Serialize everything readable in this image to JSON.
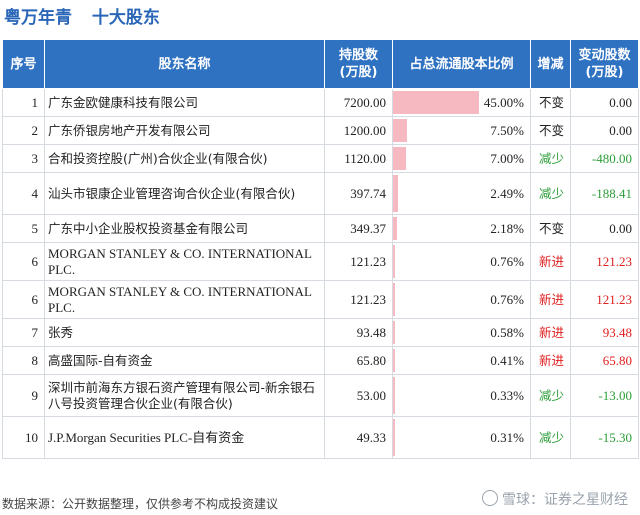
{
  "header": {
    "company": "粤万年青",
    "subtitle": "十大股东"
  },
  "columns": [
    "序号",
    "股东名称",
    "持股数\n(万股)",
    "占总流通股本比例",
    "增减",
    "变动股数\n(万股)"
  ],
  "rows": [
    {
      "idx": "1",
      "name": "广东金欧健康科技有限公司",
      "shares": "7200.00",
      "pct": "45.00%",
      "pct_value": 45.0,
      "change": "不变",
      "change_type": "same",
      "delta": "0.00"
    },
    {
      "idx": "2",
      "name": "广东侨银房地产开发有限公司",
      "shares": "1200.00",
      "pct": "7.50%",
      "pct_value": 7.5,
      "change": "不变",
      "change_type": "same",
      "delta": "0.00"
    },
    {
      "idx": "3",
      "name": "合和投资控股(广州)合伙企业(有限合伙)",
      "shares": "1120.00",
      "pct": "7.00%",
      "pct_value": 7.0,
      "change": "减少",
      "change_type": "down",
      "delta": "-480.00"
    },
    {
      "idx": "4",
      "name": "汕头市银康企业管理咨询合伙企业(有限合伙)",
      "shares": "397.74",
      "pct": "2.49%",
      "pct_value": 2.49,
      "change": "减少",
      "change_type": "down",
      "delta": "-188.41"
    },
    {
      "idx": "5",
      "name": "广东中小企业股权投资基金有限公司",
      "shares": "349.37",
      "pct": "2.18%",
      "pct_value": 2.18,
      "change": "不变",
      "change_type": "same",
      "delta": "0.00"
    },
    {
      "idx": "6",
      "name": "MORGAN STANLEY & CO. INTERNATIONAL PLC.",
      "shares": "121.23",
      "pct": "0.76%",
      "pct_value": 0.76,
      "change": "新进",
      "change_type": "up",
      "delta": "121.23"
    },
    {
      "idx": "6",
      "name": "MORGAN STANLEY & CO. INTERNATIONAL PLC.",
      "shares": "121.23",
      "pct": "0.76%",
      "pct_value": 0.76,
      "change": "新进",
      "change_type": "up",
      "delta": "121.23"
    },
    {
      "idx": "7",
      "name": "张秀",
      "shares": "93.48",
      "pct": "0.58%",
      "pct_value": 0.58,
      "change": "新进",
      "change_type": "up",
      "delta": "93.48"
    },
    {
      "idx": "8",
      "name": "高盛国际-自有资金",
      "shares": "65.80",
      "pct": "0.41%",
      "pct_value": 0.41,
      "change": "新进",
      "change_type": "up",
      "delta": "65.80"
    },
    {
      "idx": "9",
      "name": "深圳市前海东方银石资产管理有限公司-新余银石八号投资管理合伙企业(有限合伙)",
      "shares": "53.00",
      "pct": "0.33%",
      "pct_value": 0.33,
      "change": "减少",
      "change_type": "down",
      "delta": "-13.00"
    },
    {
      "idx": "10",
      "name": "J.P.Morgan Securities PLC-自有资金",
      "shares": "49.33",
      "pct": "0.31%",
      "pct_value": 0.31,
      "change": "减少",
      "change_type": "down",
      "delta": "-15.30"
    }
  ],
  "footer": {
    "source": "数据来源：公开数据整理，仅供参考不构成投资建议"
  },
  "watermark": {
    "text": "雪球：证券之星财经"
  },
  "colors": {
    "header_bg": "#2f72c2",
    "title": "#2a66b8",
    "bar": "#f6b9c2",
    "up": "#e01e1e",
    "down": "#2e9e3a"
  }
}
